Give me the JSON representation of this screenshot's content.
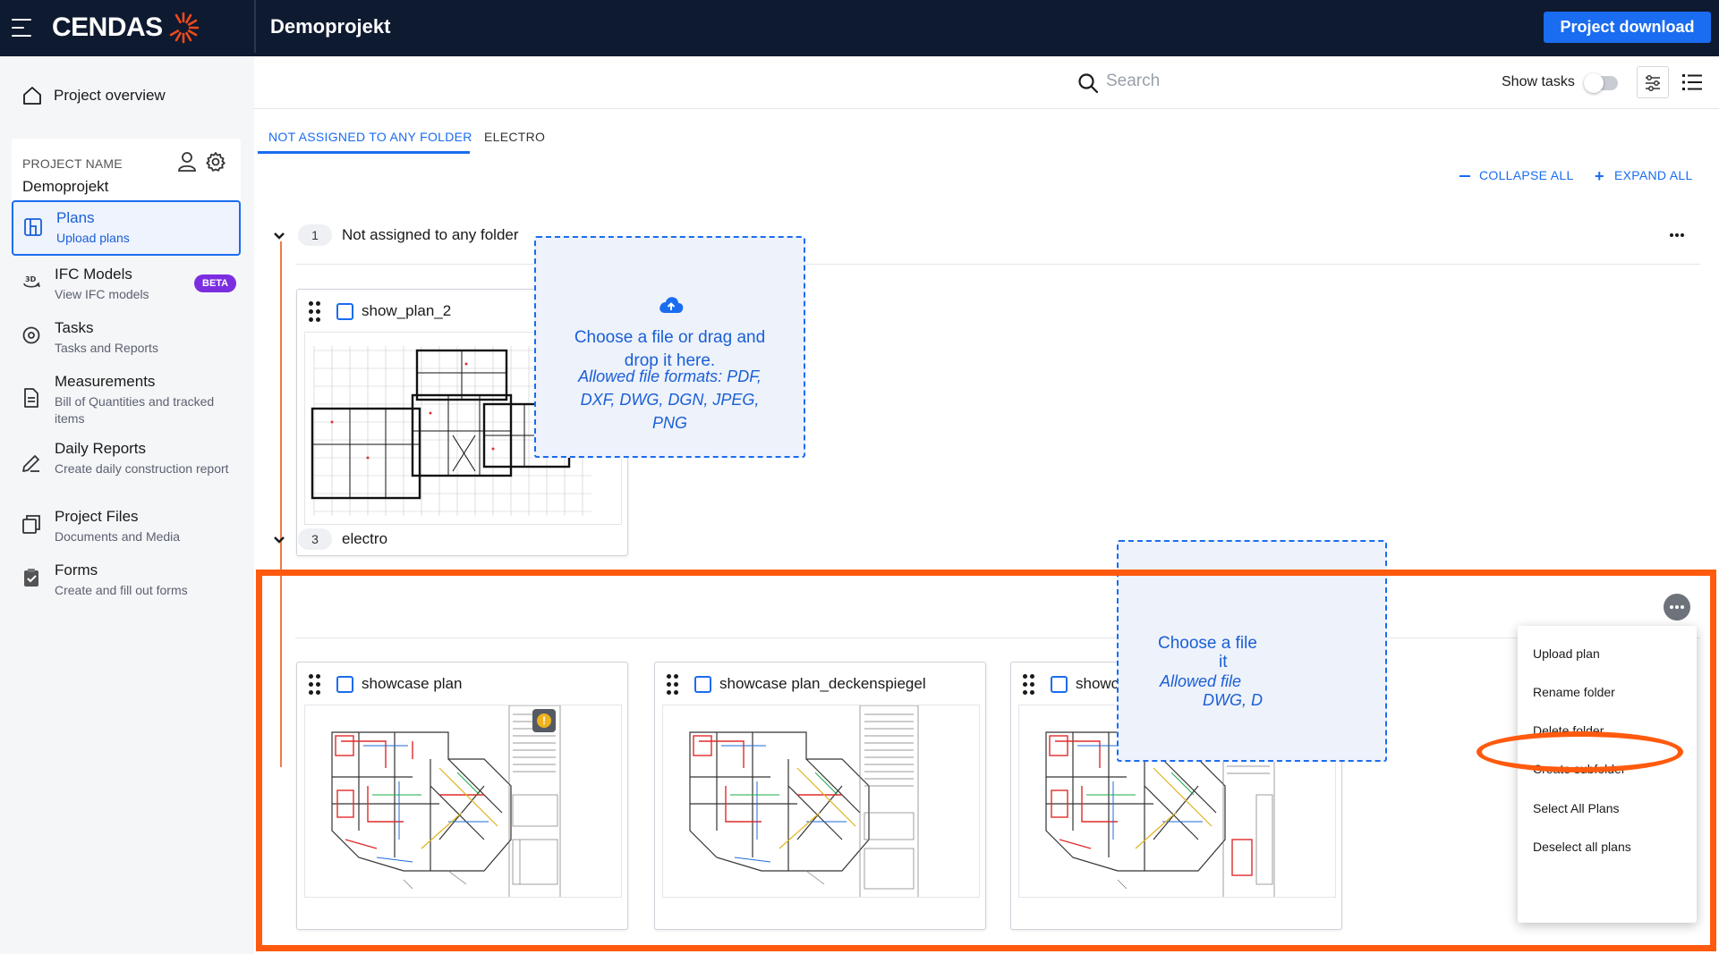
{
  "header": {
    "brand": "CENDAS",
    "project_title": "Demoprojekt",
    "download_label": "Project download"
  },
  "sidebar": {
    "overview_label": "Project overview",
    "project_caption": "PROJECT NAME",
    "project_name": "Demoprojekt",
    "items": [
      {
        "title": "Plans",
        "subtitle": "Upload plans"
      },
      {
        "title": "IFC Models",
        "subtitle": "View IFC models",
        "badge": "BETA"
      },
      {
        "title": "Tasks",
        "subtitle": "Tasks and Reports"
      },
      {
        "title": "Measurements",
        "subtitle": "Bill of Quantities and tracked items"
      },
      {
        "title": "Daily Reports",
        "subtitle": "Create daily construction report"
      },
      {
        "title": "Project Files",
        "subtitle": "Documents and Media"
      },
      {
        "title": "Forms",
        "subtitle": "Create and fill out forms"
      }
    ]
  },
  "toolbar": {
    "search_placeholder": "Search",
    "show_tasks_label": "Show tasks",
    "show_tasks_on": false
  },
  "tabs": [
    {
      "label": "NOT ASSIGNED TO ANY FOLDER",
      "active": true
    },
    {
      "label": "ELECTRO",
      "active": false
    }
  ],
  "controls": {
    "collapse_all": "COLLAPSE ALL",
    "expand_all": "EXPAND ALL"
  },
  "folders": [
    {
      "count": "1",
      "name": "Not assigned to any folder",
      "plans": [
        {
          "name": "show_plan_2"
        }
      ]
    },
    {
      "count": "3",
      "name": "electro",
      "plans": [
        {
          "name": "showcase plan",
          "warning": true
        },
        {
          "name": "showcase plan_deckenspiegel"
        },
        {
          "name": "showcase plan_grundriss eg"
        }
      ]
    }
  ],
  "dropzone": {
    "title": "Choose a file or drag and drop it here.",
    "formats": "Allowed file formats: PDF, DXF, DWG, DGN, JPEG, PNG",
    "title_partial_1": "Choose a file",
    "title_partial_2": "it",
    "formats_partial_1": "Allowed file",
    "formats_partial_2": "DWG, D"
  },
  "folder_menu": {
    "items": [
      "Upload plan",
      "Rename folder",
      "Delete folder",
      "Create subfolder",
      "Select All Plans",
      "Deselect all plans"
    ],
    "highlighted": "Delete folder"
  },
  "colors": {
    "accent": "#1a6cf0",
    "header_bg": "#0e1a30",
    "highlight": "#ff5a0e",
    "beta": "#7b2ee0"
  }
}
